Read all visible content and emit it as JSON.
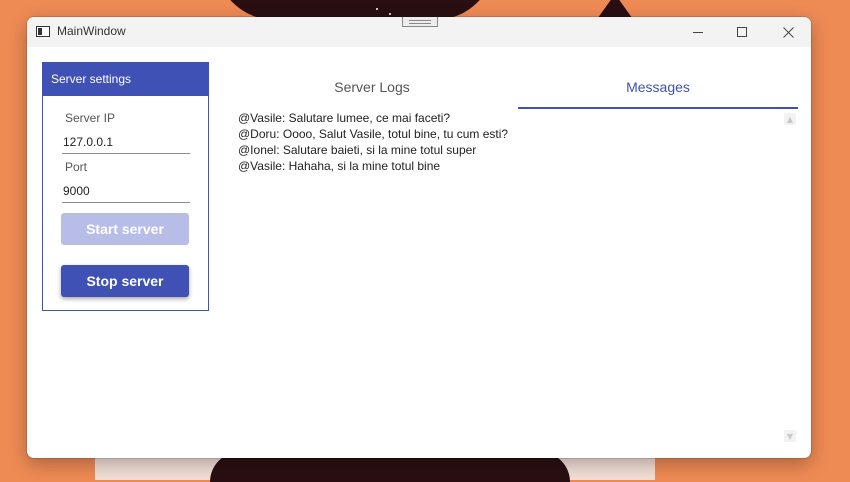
{
  "window": {
    "title": "MainWindow"
  },
  "titlebar_buttons": {
    "minimize_icon": "minimize-icon",
    "maximize_icon": "maximize-icon",
    "close_icon": "close-icon"
  },
  "settings": {
    "header": "Server settings",
    "ip_label": "Server IP",
    "ip_value": "127.0.0.1",
    "port_label": "Port",
    "port_value": "9000",
    "start_label": "Start server",
    "stop_label": "Stop server"
  },
  "tabs": [
    {
      "label": "Server Logs",
      "selected": false
    },
    {
      "label": "Messages",
      "selected": true
    }
  ],
  "messages": [
    "@Vasile: Salutare lumee, ce mai faceti?",
    "@Doru: Oooo, Salut Vasile, totul bine, tu cum esti?",
    "@Ionel: Salutare baieti, si la mine totul super",
    "@Vasile: Hahaha, si la mine totul bine"
  ],
  "colors": {
    "accent": "#3f51b5",
    "accent_disabled": "#b7bde6",
    "desktop": "#ee8a54"
  }
}
